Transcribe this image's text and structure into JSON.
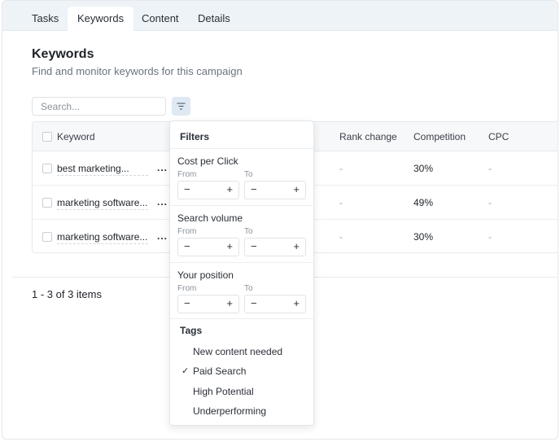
{
  "tabs": [
    "Tasks",
    "Keywords",
    "Content",
    "Details"
  ],
  "page": {
    "title": "Keywords",
    "subtitle": "Find and monitor keywords for this campaign"
  },
  "search": {
    "placeholder": "Search..."
  },
  "table": {
    "columns": [
      "Keyword",
      "Rank change",
      "Competition",
      "CPC"
    ],
    "rows": [
      {
        "keyword": "best marketing...",
        "rank_change": "-",
        "competition": "30%",
        "cpc": "-"
      },
      {
        "keyword": "marketing software...",
        "rank_change": "-",
        "competition": "49%",
        "cpc": "-"
      },
      {
        "keyword": "marketing software...",
        "rank_change": "-",
        "competition": "30%",
        "cpc": "-"
      }
    ],
    "row_menu": "..."
  },
  "pager": {
    "summary": "1 - 3 of 3 items"
  },
  "filters": {
    "title": "Filters",
    "ranges": [
      {
        "label": "Cost per Click",
        "from_label": "From",
        "to_label": "To"
      },
      {
        "label": "Search volume",
        "from_label": "From",
        "to_label": "To"
      },
      {
        "label": "Your position",
        "from_label": "From",
        "to_label": "To"
      }
    ],
    "stepper": {
      "minus": "−",
      "plus": "+"
    },
    "tags_title": "Tags",
    "tags": [
      {
        "label": "New content needed",
        "checked": false
      },
      {
        "label": "Paid Search",
        "checked": true
      },
      {
        "label": "High Potential",
        "checked": false
      },
      {
        "label": "Underperforming",
        "checked": false
      }
    ],
    "check_mark": "✓"
  },
  "icons": {
    "filter": "filter-icon",
    "check": "check-icon",
    "more": "more-icon"
  },
  "colors": {
    "tabbar_bg": "#eef3f8",
    "filter_button_bg": "#dfe9f3",
    "header_bg": "#f6f8fa"
  }
}
